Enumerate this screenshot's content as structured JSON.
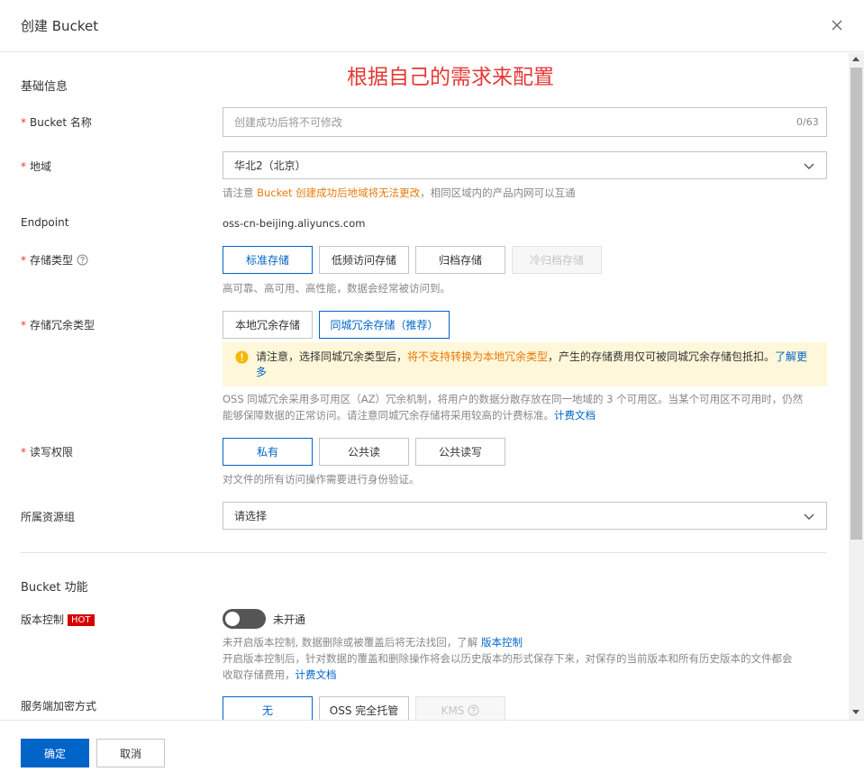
{
  "dialog": {
    "title": "创建 Bucket"
  },
  "annotation": "根据自己的需求来配置",
  "basic": {
    "section_title": "基础信息",
    "bucket_name": {
      "label": "Bucket 名称",
      "placeholder": "创建成功后将不可修改",
      "count": "0/63"
    },
    "region": {
      "label": "地域",
      "value": "华北2（北京）",
      "help_prefix": "请注意 ",
      "help_highlight": "Bucket 创建成功后地域将无法更改",
      "help_suffix": "，相同区域内的产品内网可以互通"
    },
    "endpoint": {
      "label": "Endpoint",
      "value": "oss-cn-beijing.aliyuncs.com"
    },
    "storage_class": {
      "label": "存储类型",
      "options": [
        "标准存储",
        "低频访问存储",
        "归档存储",
        "冷归档存储"
      ],
      "help": "高可靠、高可用、高性能，数据会经常被访问到。"
    },
    "redundancy": {
      "label": "存储冗余类型",
      "options": [
        "本地冗余存储",
        "同城冗余存储（推荐）"
      ],
      "warn_prefix": "请注意，选择同城冗余类型后，",
      "warn_highlight": "将不支持转换为本地冗余类型",
      "warn_suffix": "，产生的存储费用仅可被同城冗余存储包抵扣。",
      "warn_link": "了解更多",
      "help_line1": "OSS 同城冗余采用多可用区（AZ）冗余机制，将用户的数据分散存放在同一地域的 3 个可用区。当某个可用区不可用时，仍然",
      "help_line2": "能够保障数据的正常访问。请注意同城冗余存储将采用较高的计费标准。",
      "help_link": "计费文档"
    },
    "acl": {
      "label": "读写权限",
      "options": [
        "私有",
        "公共读",
        "公共读写"
      ],
      "help": "对文件的所有访问操作需要进行身份验证。"
    },
    "resource_group": {
      "label": "所属资源组",
      "placeholder": "请选择"
    }
  },
  "features": {
    "section_title": "Bucket 功能",
    "versioning": {
      "label": "版本控制",
      "badge": "HOT",
      "state": "未开通",
      "help_line1": "未开启版本控制, 数据删除或被覆盖后将无法找回，了解 ",
      "help_link1": "版本控制",
      "help_line2": "开启版本控制后，针对数据的覆盖和删除操作将会以历史版本的形式保存下来，对保存的当前版本和所有历史版本的文件都会",
      "help_line3": "收取存储费用，",
      "help_link2": "计费文档"
    },
    "encryption": {
      "label": "服务端加密方式",
      "options": [
        "无",
        "OSS 完全托管",
        "KMS"
      ]
    }
  },
  "footer": {
    "ok": "确定",
    "cancel": "取消"
  },
  "colors": {
    "primary": "#0064c8",
    "warning": "#e87a0a",
    "annotation": "#e53935",
    "hot": "#d60000"
  }
}
